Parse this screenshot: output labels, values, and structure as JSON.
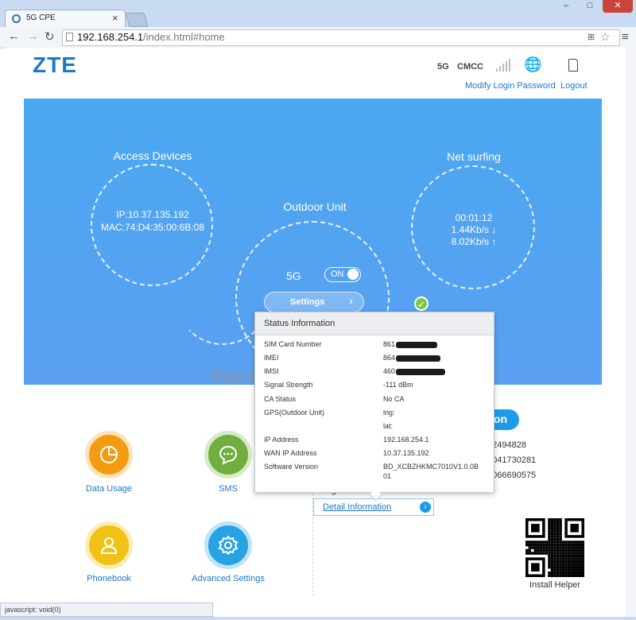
{
  "browser": {
    "tab_title": "5G CPE",
    "url_host": "192.168.254.1",
    "url_path": "/index.html#home",
    "status_text": "javascript: void(0)"
  },
  "header": {
    "logo": "ZTE",
    "network_type": "5G",
    "carrier": "CMCC",
    "modify_password": "Modify Login Password",
    "logout": "Logout"
  },
  "banner": {
    "access_title": "Access Devices",
    "access_ip": "IP:10.37.135.192",
    "access_mac": "MAC:74:D4:35:00:6B:08",
    "outdoor_title": "Outdoor Unit",
    "net_title": "Net surfing",
    "net_time": "00:01:12",
    "net_down": "1.44Kb/s ↓",
    "net_up": "8.02Kb/s ↑",
    "mode_label": "5G",
    "toggle_label": "ON",
    "settings_label": "Settings"
  },
  "features": {
    "data_usage": "Data Usage",
    "sms": "SMS",
    "phonebook": "Phonebook",
    "advanced_settings": "Advanced Settings"
  },
  "status_panel": {
    "pill_text": "ion",
    "values": [
      "12494828",
      "5041730281",
      "5066690575",
      "Bm"
    ],
    "partial_label": "Signal Stren",
    "detail_link": "Detail Information",
    "install_helper": "Install Helper"
  },
  "watermark": "Store No.611497",
  "popup": {
    "title": "Status Information",
    "rows": [
      {
        "label": "SIM Card Number",
        "value": "861"
      },
      {
        "label": "IMEI",
        "value": "864"
      },
      {
        "label": "IMSI",
        "value": "460"
      },
      {
        "label": "Signal Strength",
        "value": "-111 dBm"
      },
      {
        "label": "CA Status",
        "value": "No CA"
      },
      {
        "label": "GPS(Outdoor Unit)",
        "value": "lng:"
      },
      {
        "label": "",
        "value": "lat:"
      },
      {
        "label": "IP Address",
        "value": "192.168.254.1"
      },
      {
        "label": "WAN IP Address",
        "value": "10.37.135.192"
      },
      {
        "label": "Software Version",
        "value": "BD_XCBZHKMC7010V1.0.0B"
      },
      {
        "label": "",
        "value": "01"
      }
    ]
  },
  "colors": {
    "brand": "#1e77c9",
    "banner": "#4aa8f0",
    "data_usage": "#f39c12",
    "sms": "#6fae3f",
    "phonebook": "#f2c118",
    "advanced_settings": "#27a3e5",
    "online_check": "#7ac943"
  },
  "icons": {
    "data_usage": "pie-chart-icon",
    "sms": "chat-bubble-icon",
    "phonebook": "user-icon",
    "advanced_settings": "gear-icon"
  }
}
